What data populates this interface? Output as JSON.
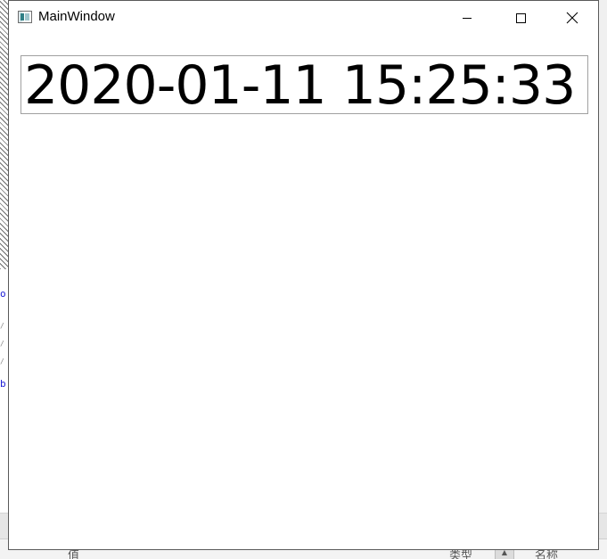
{
  "window": {
    "title": "MainWindow",
    "icon": "app-window-icon"
  },
  "caption_buttons": {
    "minimize_icon": "minimize-icon",
    "maximize_icon": "maximize-icon",
    "close_icon": "close-icon"
  },
  "main": {
    "datetime": "2020-01-11 15:25:33"
  },
  "background": {
    "bottom_cells": [
      "值",
      "类型",
      "名称"
    ]
  }
}
